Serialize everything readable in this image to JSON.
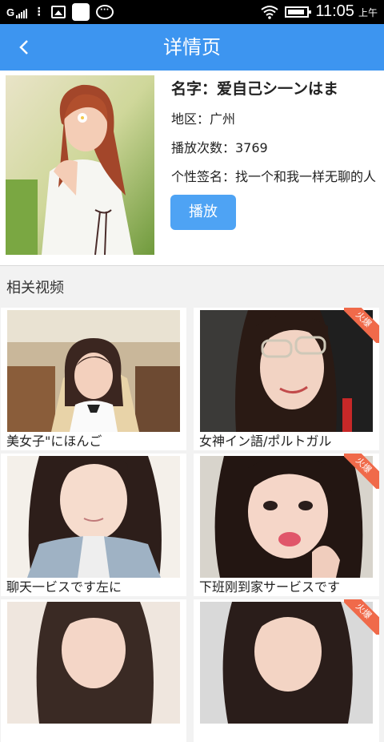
{
  "status_bar": {
    "carrier": "Gᴵᴵᴵᴵ",
    "chat_glyph": "···",
    "time": "11:05",
    "ampm": "上午"
  },
  "header": {
    "back_glyph": "<",
    "title": "详情页"
  },
  "profile": {
    "name": "名字：爱自己シ一ンはま",
    "region": "地区：广州",
    "plays": "播放次数：3769",
    "signature": "个性签名：找一个和我一样无聊的人",
    "play_button": "播放"
  },
  "related": {
    "title": "相关视频",
    "badge_text": "火爆",
    "items": [
      {
        "caption": "美女子\"にほんご",
        "hot": false
      },
      {
        "caption": "女神イン語/ポルトガル",
        "hot": true
      },
      {
        "caption": "聊天一ビスです左に",
        "hot": false
      },
      {
        "caption": "下班刚到家サービスです",
        "hot": true
      },
      {
        "caption": "",
        "hot": false
      },
      {
        "caption": "",
        "hot": true
      }
    ]
  }
}
